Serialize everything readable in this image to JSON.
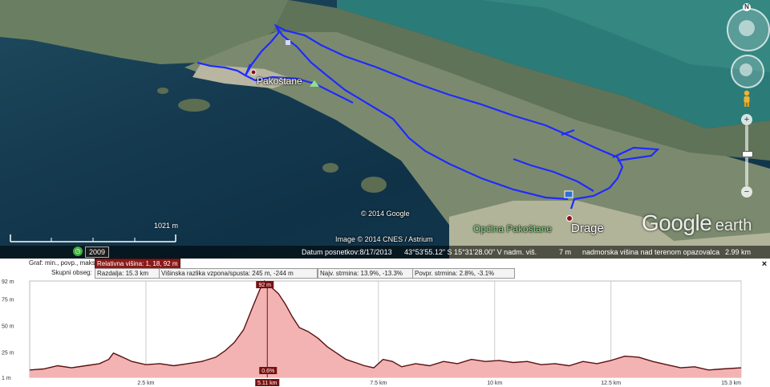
{
  "map": {
    "places": {
      "pakostane": "Pakoštane",
      "drage": "Drage",
      "opcina": "Općina Pakoštane"
    },
    "copyright_google": "© 2014 Google",
    "copyright_image": "Image © 2014 CNES / Astrium",
    "logo_google": "Google",
    "logo_earth": "earth",
    "scale_label": "1021 m",
    "year_badge": "2009",
    "status": {
      "date": "Datum posnetkov:8/17/2013",
      "coords": "43°53'55.12\" S   15°31'28.00\" V  nadm. viš.",
      "elev_value": "7 m",
      "eye_label": "nadmorska višina nad terenom opazovalca",
      "eye_value": "2.99 km"
    },
    "nav": {
      "north": "N"
    },
    "track_color": "#1f2bff"
  },
  "profile": {
    "header": {
      "graf_label": "Graf: min., povp., maks.:",
      "graf_value": "Relativna višina: 1, 18, 92 m",
      "obseg_label": "Skupni obseg:",
      "razdalja": "Razdalja: 15.3 km",
      "visinska": "Višinska razlika vzpona/spusta: 245 m, -244 m",
      "najv": "Najv. strmina: 13.9%, -13.3%",
      "povpr": "Povpr. strmina: 2.8%, -3.1%"
    },
    "close_icon": "×",
    "cursor": {
      "distance_km": 5.11,
      "distance_label": "5.11 km",
      "elevation_label": "92 m",
      "slope_label": "0.6%"
    }
  },
  "chart_data": {
    "type": "area",
    "xlabel": "",
    "ylabel": "",
    "xlim": [
      0,
      15.3
    ],
    "ylim": [
      1,
      92
    ],
    "y_ticks": [
      {
        "v": 92,
        "label": "92 m"
      },
      {
        "v": 75,
        "label": "75 m"
      },
      {
        "v": 50,
        "label": "50 m"
      },
      {
        "v": 25,
        "label": "25 m"
      },
      {
        "v": 1,
        "label": "1 m"
      }
    ],
    "x_ticks": [
      {
        "v": 2.5,
        "label": "2.5 km"
      },
      {
        "v": 5.11,
        "label": "5.11 km"
      },
      {
        "v": 7.5,
        "label": "7.5 km"
      },
      {
        "v": 10,
        "label": "10 km"
      },
      {
        "v": 12.5,
        "label": "12.5 km"
      },
      {
        "v": 15.3,
        "label": "15.3 km"
      }
    ],
    "grid": true,
    "fill_color": "#f3b3b3",
    "line_color": "#5a1010",
    "series": [
      {
        "x": [
          0,
          0.3,
          0.6,
          0.9,
          1.2,
          1.5,
          1.7,
          1.8,
          1.9,
          2.0,
          2.2,
          2.5,
          2.8,
          3.1,
          3.4,
          3.7,
          4.0,
          4.2,
          4.4,
          4.6,
          4.8,
          4.95,
          5.05,
          5.11,
          5.2,
          5.35,
          5.5,
          5.65,
          5.8,
          6.0,
          6.2,
          6.4,
          6.6,
          6.8,
          7.0,
          7.2,
          7.4,
          7.6,
          7.8,
          8.0,
          8.3,
          8.6,
          8.9,
          9.2,
          9.5,
          9.8,
          10.1,
          10.4,
          10.7,
          11.0,
          11.3,
          11.6,
          11.9,
          12.2,
          12.5,
          12.8,
          13.1,
          13.4,
          13.7,
          14.0,
          14.3,
          14.6,
          14.9,
          15.3
        ],
        "y": [
          8,
          9,
          12,
          10,
          12,
          14,
          18,
          24,
          22,
          20,
          16,
          13,
          14,
          12,
          14,
          16,
          20,
          26,
          34,
          46,
          68,
          84,
          92,
          90,
          86,
          80,
          70,
          58,
          48,
          44,
          38,
          30,
          24,
          18,
          15,
          12,
          10,
          18,
          16,
          11,
          14,
          12,
          16,
          14,
          18,
          16,
          17,
          15,
          16,
          13,
          14,
          12,
          16,
          14,
          17,
          21,
          20,
          16,
          13,
          10,
          11,
          8,
          9,
          10
        ]
      }
    ]
  }
}
